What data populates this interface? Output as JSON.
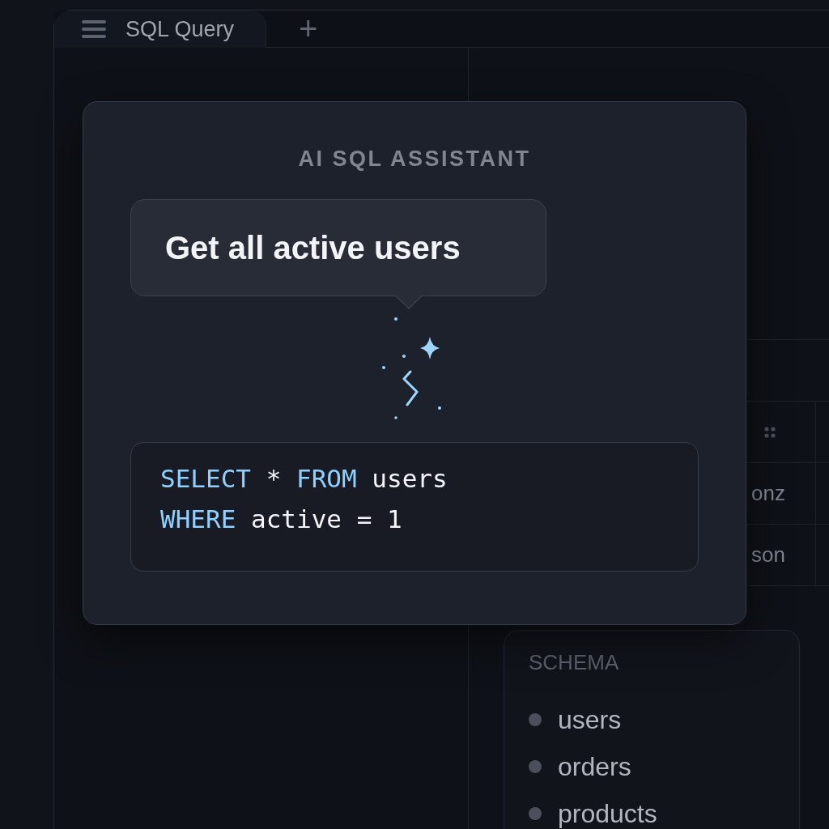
{
  "tabs": [
    {
      "label": "SQL Query",
      "selected": true
    }
  ],
  "add_tab": {
    "label": "+"
  },
  "results": {
    "rows": [
      {
        "cell": "onz"
      },
      {
        "cell": "son"
      }
    ]
  },
  "schema": {
    "title": "SCHEMA",
    "items": [
      {
        "name": "users"
      },
      {
        "name": "orders"
      },
      {
        "name": "products"
      }
    ]
  },
  "assistant": {
    "title": "AI SQL ASSISTANT",
    "prompt": "Get all active users",
    "code": [
      [
        {
          "kind": "keyword",
          "text": "SELECT"
        },
        {
          "kind": "plain",
          "text": " * "
        },
        {
          "kind": "keyword",
          "text": "FROM"
        },
        {
          "kind": "plain",
          "text": " users"
        }
      ],
      [
        {
          "kind": "keyword",
          "text": "WHERE"
        },
        {
          "kind": "plain",
          "text": " active = 1"
        }
      ]
    ]
  }
}
